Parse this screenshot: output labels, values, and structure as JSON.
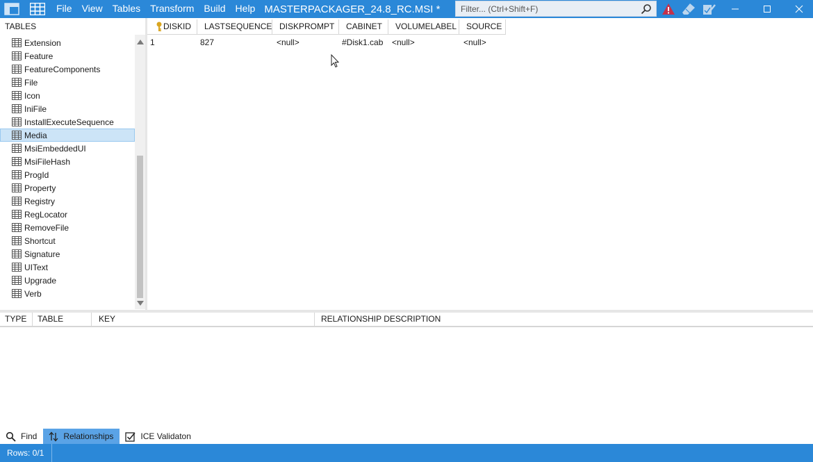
{
  "titlebar": {
    "menu": [
      "File",
      "View",
      "Tables",
      "Transform",
      "Build",
      "Help"
    ],
    "title": "MASTERPACKAGER_24.8_RC.MSI * |...",
    "filter_placeholder": "Filter... (Ctrl+Shift+F)"
  },
  "left_panel": {
    "header": "TABLES",
    "items": [
      {
        "label": "Extension"
      },
      {
        "label": "Feature"
      },
      {
        "label": "FeatureComponents"
      },
      {
        "label": "File"
      },
      {
        "label": "Icon"
      },
      {
        "label": "IniFile"
      },
      {
        "label": "InstallExecuteSequence"
      },
      {
        "label": "Media",
        "selected": true
      },
      {
        "label": "MsiEmbeddedUI"
      },
      {
        "label": "MsiFileHash"
      },
      {
        "label": "ProgId"
      },
      {
        "label": "Property"
      },
      {
        "label": "Registry"
      },
      {
        "label": "RegLocator"
      },
      {
        "label": "RemoveFile"
      },
      {
        "label": "Shortcut"
      },
      {
        "label": "Signature"
      },
      {
        "label": "UIText"
      },
      {
        "label": "Upgrade"
      },
      {
        "label": "Verb"
      }
    ]
  },
  "grid": {
    "columns": [
      "DISKID",
      "LASTSEQUENCE",
      "DISKPROMPT",
      "CABINET",
      "VOLUMELABEL",
      "SOURCE"
    ],
    "rows": [
      [
        "1",
        "827",
        "<null>",
        "#Disk1.cab",
        "<null>",
        "<null>"
      ]
    ]
  },
  "relationships": {
    "columns": [
      "TYPE",
      "TABLE",
      "KEY",
      "RELATIONSHIP DESCRIPTION"
    ]
  },
  "tabs": [
    {
      "label": "Find",
      "icon": "search-icon"
    },
    {
      "label": "Relationships",
      "icon": "relationships-icon",
      "active": true
    },
    {
      "label": "ICE Validaton",
      "icon": "checkbox-icon"
    }
  ],
  "status": {
    "rows": "Rows: 0/1"
  },
  "colors": {
    "accent": "#2b88d8",
    "selection": "#cce4f7",
    "active_tab": "#5aa3e6"
  }
}
